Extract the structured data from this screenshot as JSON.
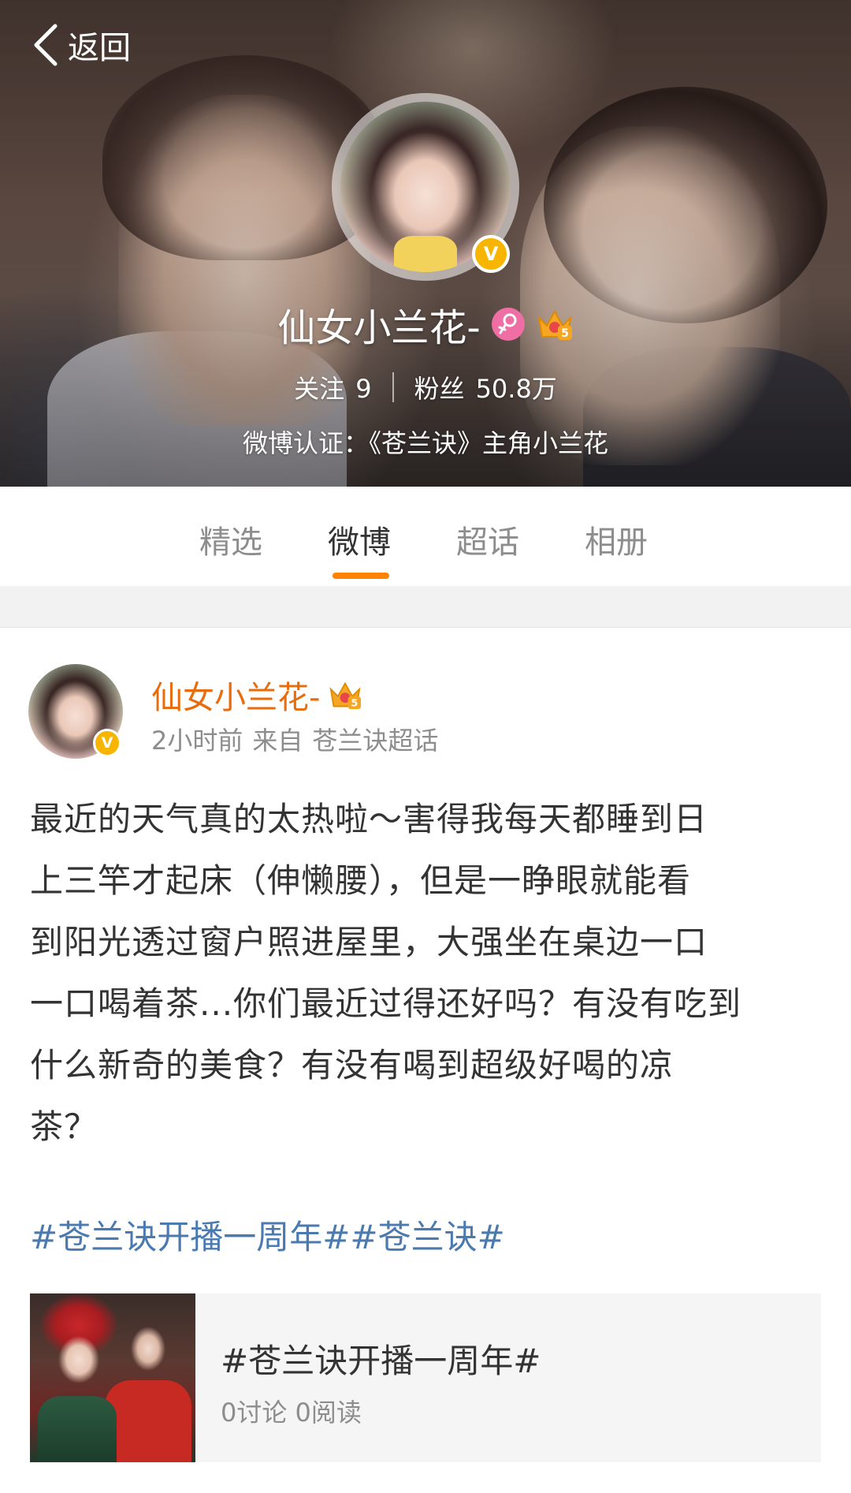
{
  "header": {
    "back_label": "返回",
    "profile_name": "仙女小兰花-",
    "following_label": "关注",
    "following_count": "9",
    "followers_label": "粉丝",
    "followers_count": "50.8万",
    "verification": "微博认证：《苍兰诀》主角小兰花",
    "verified_badge": "V",
    "member_level": "5"
  },
  "tabs": [
    {
      "label": "精选",
      "active": false
    },
    {
      "label": "微博",
      "active": true
    },
    {
      "label": "超话",
      "active": false
    },
    {
      "label": "相册",
      "active": false
    }
  ],
  "post": {
    "author": "仙女小兰花-",
    "time": "2小时前",
    "source_prefix": "来自",
    "source": "苍兰诀超话",
    "lines": [
      "最近的天气真的太热啦～害得我每天都睡到日",
      "上三竿才起床（伸懒腰），但是一睁眼就能看",
      "到阳光透过窗户照进屋里，大强坐在桌边一口",
      "一口喝着茶...你们最近过得还好吗？有没有吃到",
      "什么新奇的美食？有没有喝到超级好喝的凉",
      "茶？"
    ],
    "hashtags": "#苍兰诀开播一周年##苍兰诀#",
    "topic_card": {
      "title": "#苍兰诀开播一周年#",
      "stats": "0讨论 0阅读"
    }
  },
  "colors": {
    "accent": "#ff8200",
    "author_name": "#e86b0c",
    "hashtag": "#4a7ab0",
    "verified_badge": "#f7b500",
    "gender_female": "#ef6fa5"
  },
  "icons": [
    "back-chevron-icon",
    "verified-v-icon",
    "female-gender-icon",
    "member-crown-icon"
  ]
}
